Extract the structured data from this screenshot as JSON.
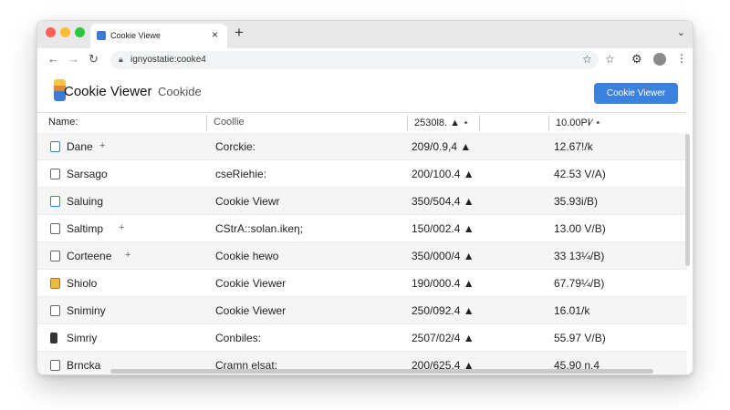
{
  "browser": {
    "tab_title": "Cookie Viewe",
    "tab_close": "×",
    "new_tab": "+",
    "tab_menu": "⌄",
    "url": "ignyostatie:cooke4",
    "nav_back": "←",
    "nav_forward": "→",
    "nav_reload": "↻",
    "bookmark_star": "☆",
    "star2": "☆",
    "extension": "⚙",
    "menu": "⋮"
  },
  "app": {
    "title": "Cookie Viewer",
    "subtitle": "Cookide",
    "primary_button": "Cookie Viewer"
  },
  "table": {
    "headers": [
      "Name:",
      "Coollie",
      "2530l8. ▲ ⋆",
      "10.00PI⁄ ⋆"
    ],
    "rows": [
      {
        "name": "Dane",
        "value": "Corckie:",
        "size": "209/0.9,4 ▲",
        "exp": "12.67!/k",
        "icon": "blue",
        "plus": "+",
        "shade": true
      },
      {
        "name": "Sarsago",
        "value": "cseRiehie:",
        "size": "200/100.4 ▲",
        "exp": "42.53 V/A)",
        "icon": "plain",
        "plus": "",
        "shade": false
      },
      {
        "name": "Saluing",
        "value": "Cookie Viewr",
        "size": "350/504,4 ▲",
        "exp": "35.93i/B)",
        "icon": "blue",
        "plus": "",
        "shade": true
      },
      {
        "name": "Saltimp",
        "value": "CStrA::solan.ikeη;",
        "size": "150/002.4 ▲",
        "exp": "13.00 V/B)",
        "icon": "plain",
        "plus": "+",
        "shade": false
      },
      {
        "name": "Corteene",
        "value": "Cookie hewo",
        "size": "350/000/4 ▲",
        "exp": "33 13¼/B)",
        "icon": "plain",
        "plus": "+",
        "shade": true
      },
      {
        "name": "Shiolo",
        "value": "Cookie Viewer",
        "size": "190/000.4 ▲",
        "exp": "67.79¼/B)",
        "icon": "folder",
        "plus": "",
        "shade": false
      },
      {
        "name": "Sniminy",
        "value": "Cookie Viewer",
        "size": "250/092.4 ▲",
        "exp": "16.01/k",
        "icon": "plain",
        "plus": "",
        "shade": true
      },
      {
        "name": "Simriy",
        "value": "Conbiles:",
        "size": "2507/02/4 ▲",
        "exp": "55.97 V/B)",
        "icon": "dark",
        "plus": "",
        "shade": false
      },
      {
        "name": "Brncka",
        "value": "Cramn elsat:",
        "size": "200/625.4 ▲",
        "exp": "45.90 n,4",
        "icon": "plain",
        "plus": "",
        "shade": true
      }
    ]
  }
}
